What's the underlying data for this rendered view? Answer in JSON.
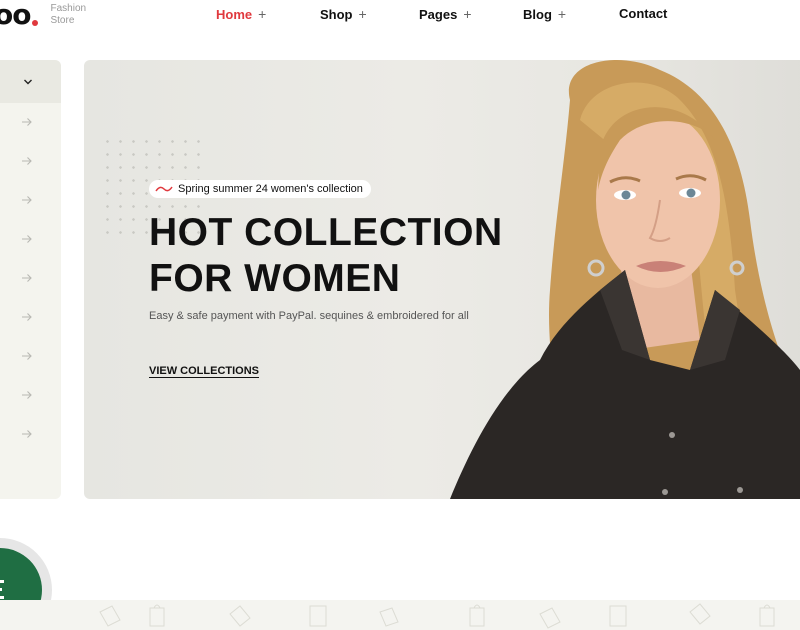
{
  "header": {
    "logo_text": "oo",
    "logo_subtitle_line1": "Fashion",
    "logo_subtitle_line2": "Store",
    "nav": [
      {
        "label": "Home",
        "has_plus": true,
        "active": true
      },
      {
        "label": "Shop",
        "has_plus": true,
        "active": false
      },
      {
        "label": "Pages",
        "has_plus": true,
        "active": false
      },
      {
        "label": "Blog",
        "has_plus": true,
        "active": false
      },
      {
        "label": "Contact",
        "has_plus": false,
        "active": false
      }
    ],
    "plus_symbol": "+"
  },
  "sidebar": {
    "toggle_icon": "chevron-down-icon",
    "item_icon": "arrow-right-icon",
    "item_count": 9
  },
  "hero": {
    "badge_text": "Spring summer 24 women's collection",
    "title_line1": "HOT COLLECTION",
    "title_line2": "FOR WOMEN",
    "subtitle": "Easy & safe payment with PayPal. sequines & embroidered for all",
    "cta_label": "VIEW COLLECTIONS"
  },
  "colors": {
    "accent": "#e0393e",
    "hero_bg": "#e9e8e3",
    "sidebar_bg": "#f4f4ee",
    "float_button": "#1f6e43"
  }
}
